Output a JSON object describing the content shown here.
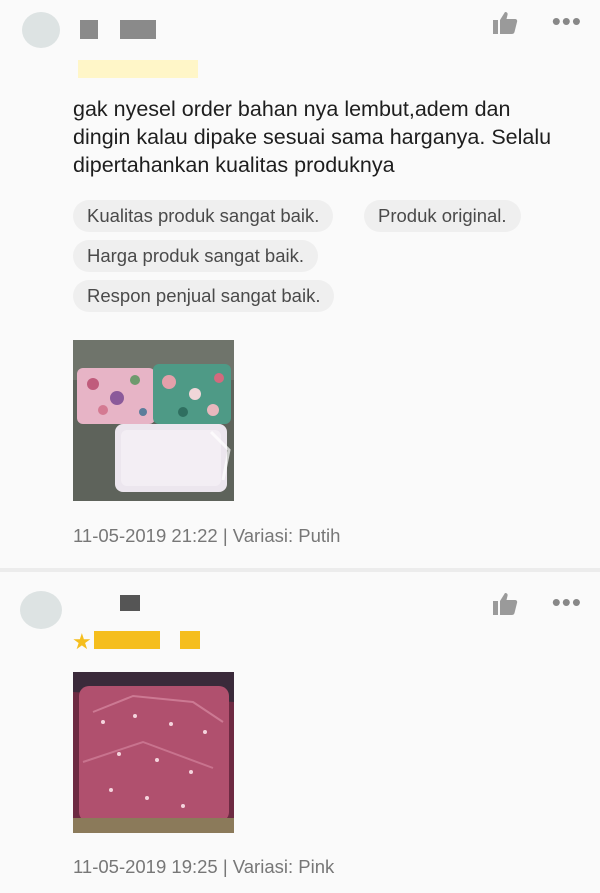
{
  "reviews": [
    {
      "comment": "gak nyesel order bahan nya lembut,adem dan dingin kalau dipake sesuai sama harganya. Selalu dipertahankan kualitas produknya",
      "tags": [
        "Kualitas produk sangat baik.",
        "Produk original.",
        "Harga produk sangat baik.",
        "Respon penjual sangat baik."
      ],
      "date": "11-05-2019 21:22",
      "separator": "|",
      "variation": "Variasi: Putih",
      "like_icon": "thumbs-up-icon",
      "more_icon": "more-dots-icon"
    },
    {
      "date": "11-05-2019 19:25",
      "separator": "|",
      "variation": "Variasi: Pink",
      "like_icon": "thumbs-up-icon",
      "more_icon": "more-dots-icon",
      "rating_star": "★"
    }
  ],
  "more_glyph": "•••",
  "colors": {
    "star": "#f5be1e",
    "tag_bg": "#efefef",
    "meta_text": "#777777"
  }
}
